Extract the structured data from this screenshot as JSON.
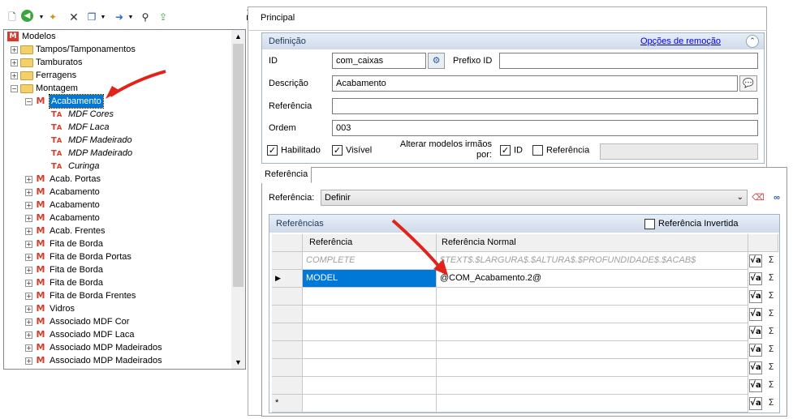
{
  "toolbar": {
    "icons": [
      "new-doc-icon",
      "back-icon",
      "new-item-icon",
      "delete-icon",
      "copy-icon",
      "move-down-icon",
      "search-icon",
      "export-icon"
    ]
  },
  "tree": {
    "root": "Modelos",
    "folders": [
      "Tampos/Tamponamentos",
      "Tamburatos",
      "Ferragens",
      "Montagem"
    ],
    "selected": "Acabamento",
    "sub_items": [
      "MDF Cores",
      "MDF Laca",
      "MDF Madeirado",
      "MDP Madeirado",
      "Curinga"
    ],
    "items": [
      "Acab. Portas",
      "Acabamento",
      "Acabamento",
      "Acabamento",
      "Acab. Frentes",
      "Fita de Borda",
      "Fita de Borda Portas",
      "Fita de Borda",
      "Fita de Borda",
      "Fita de Borda Frentes",
      "Vidros",
      "Associado MDF Cor",
      "Associado MDF Laca",
      "Associado MDP Madeirados",
      "Associado MDP Madeirados"
    ]
  },
  "main": {
    "tab": "Principal",
    "definicao": {
      "title": "Definição",
      "remove_link": "Opções de remoção",
      "id_label": "ID",
      "id_value": "com_caixas",
      "prefix_label": "Prefixo ID",
      "prefix_value": "",
      "desc_label": "Descrição",
      "desc_value": "Acabamento",
      "ref_label": "Referência",
      "ref_value": "",
      "order_label": "Ordem",
      "order_value": "003",
      "enabled_label": "Habilitado",
      "visible_label": "Visível",
      "alter_label": "Alterar modelos irmãos por:",
      "alter_id": "ID",
      "alter_ref": "Referência"
    },
    "referencia": {
      "tab": "Referência",
      "combo_label": "Referência:",
      "combo_value": "Definir",
      "group_title": "Referências",
      "inverted_label": "Referência Invertida",
      "col_ref": "Referência",
      "col_norm": "Referência Normal",
      "rows": [
        {
          "ref": "COMPLETE",
          "norm": "$TEXT$.$LARGURA$.$ALTURA$.$PROFUNDIDADE$.$ACAB$"
        },
        {
          "ref": "MODEL",
          "norm": "@COM_Acabamento.2@"
        }
      ],
      "sigma": "Σ",
      "sqrt": "√a",
      "row_marker": "▶",
      "new_marker": "*"
    }
  }
}
